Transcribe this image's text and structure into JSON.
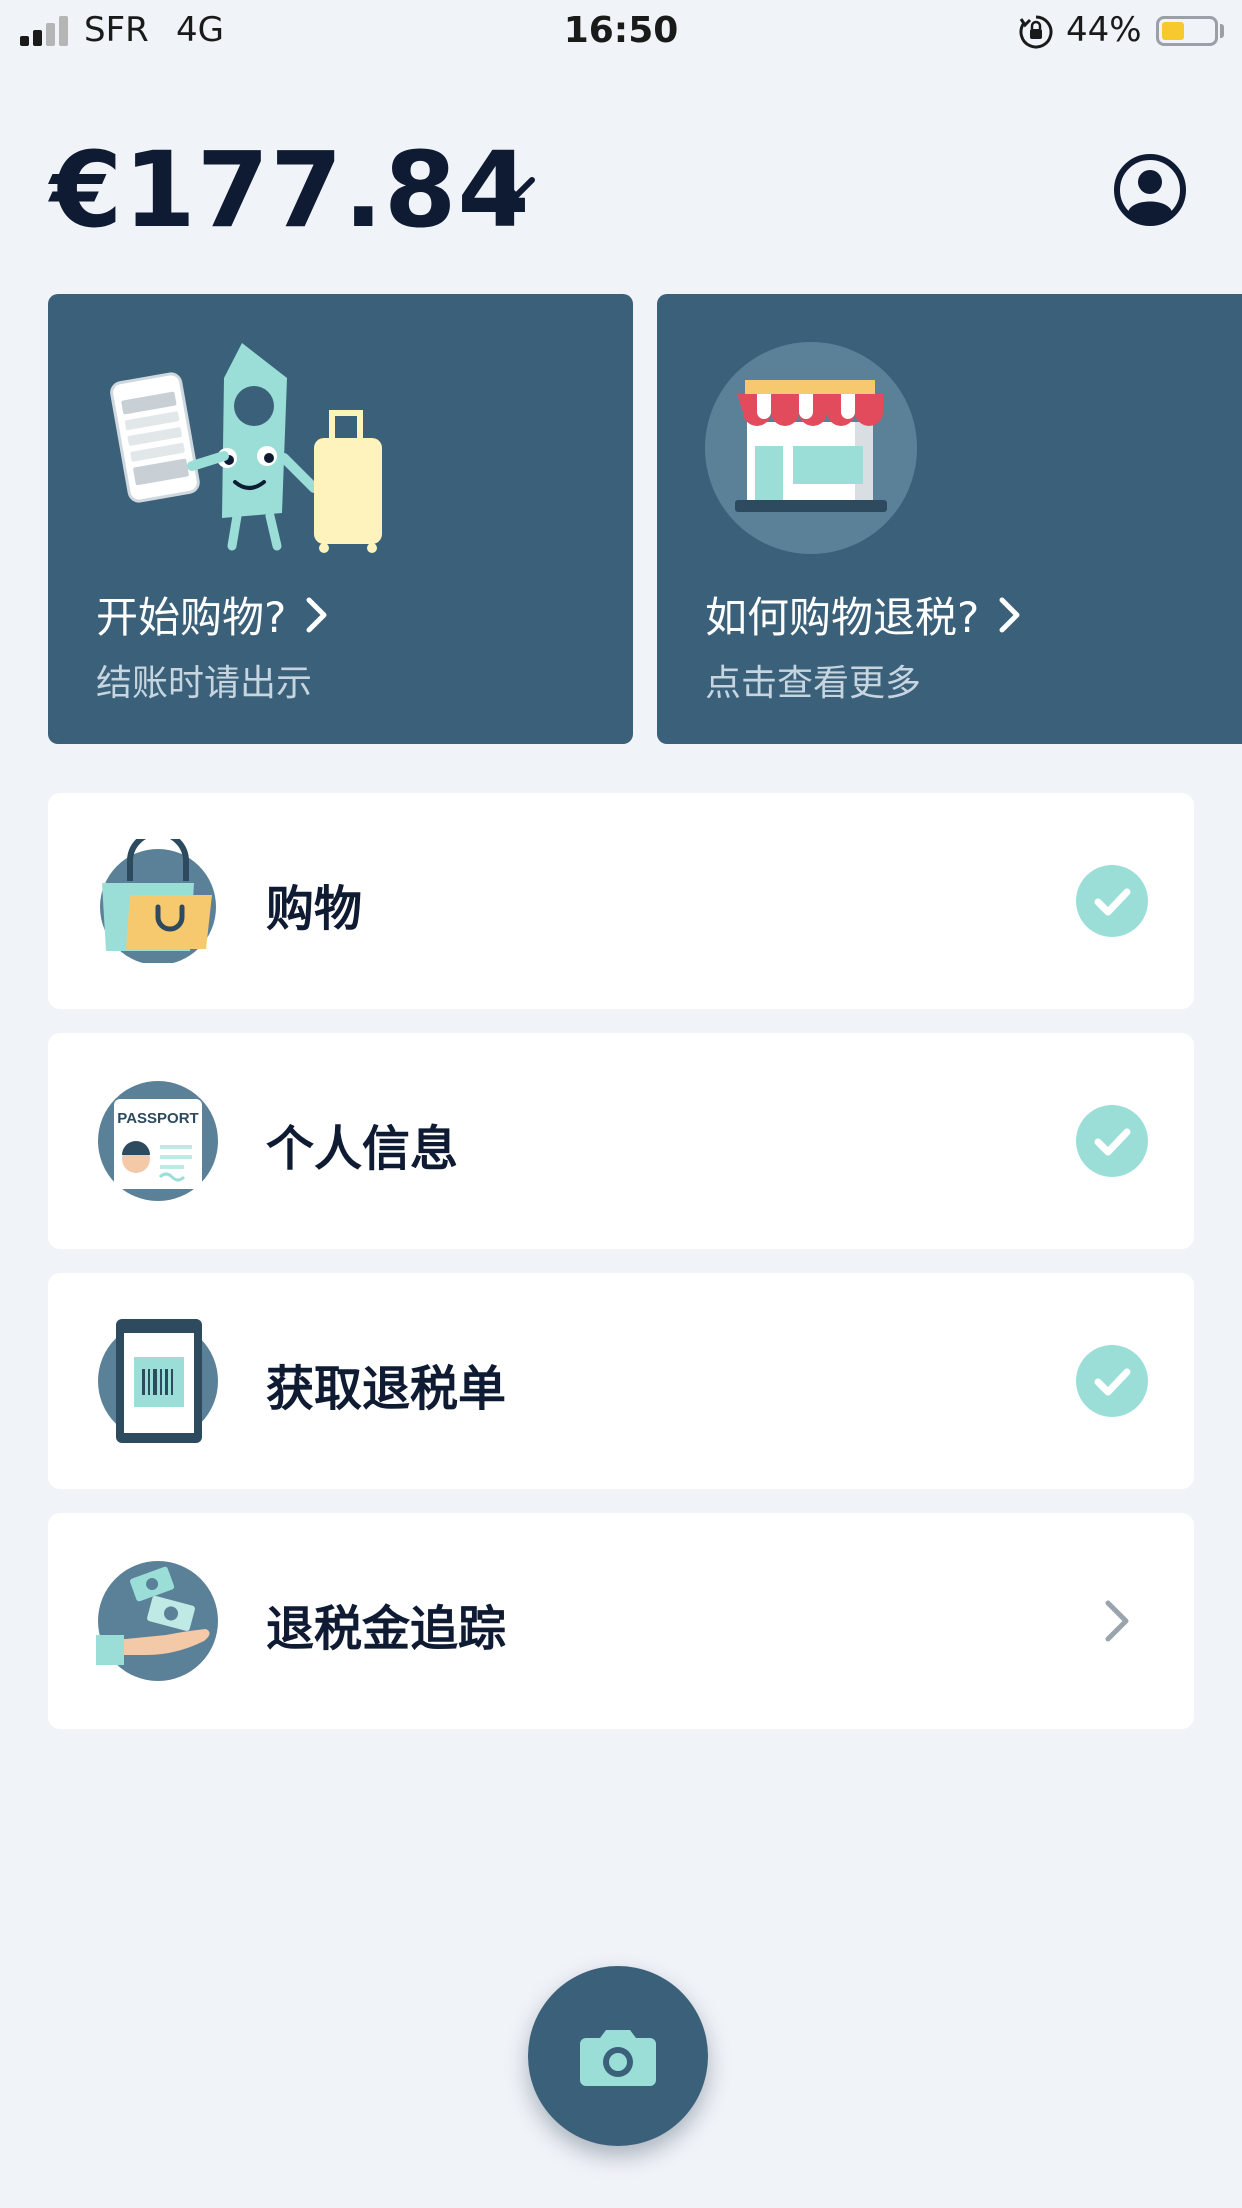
{
  "status_bar": {
    "carrier": "SFR",
    "network": "4G",
    "time": "16:50",
    "battery_percent": "44%",
    "battery_level": 0.44
  },
  "header": {
    "balance": "€177.84",
    "chevron_icon": "chevron-down-icon",
    "profile_icon": "user-circle-icon"
  },
  "cards": [
    {
      "title": "开始购物?",
      "subtitle": "结账时请出示",
      "icon": "chevron-right-icon"
    },
    {
      "title": "如何购物退税?",
      "subtitle": "点击查看更多",
      "icon": "chevron-right-icon"
    }
  ],
  "steps": [
    {
      "label": "购物",
      "status": "done",
      "icon": "shopping-bag-icon"
    },
    {
      "label": "个人信息",
      "status": "done",
      "icon": "passport-icon"
    },
    {
      "label": "获取退税单",
      "status": "done",
      "icon": "barcode-phone-icon"
    },
    {
      "label": "退税金追踪",
      "status": "pending",
      "icon": "money-hand-icon"
    }
  ],
  "fab": {
    "icon": "camera-icon"
  },
  "colors": {
    "background": "#f0f3f8",
    "card": "#3b6079",
    "accent": "#9bded8",
    "text": "#0f1b33"
  }
}
